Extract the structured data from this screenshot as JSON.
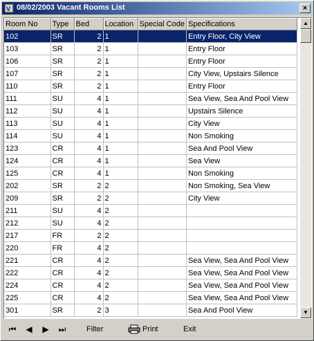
{
  "window": {
    "title": "08/02/2003 Vacant Rooms List",
    "close_label": "×"
  },
  "columns": [
    "Room No",
    "Type",
    "Bed",
    "Location",
    "Special Code",
    "Specifications"
  ],
  "rows": [
    [
      "102",
      "SR",
      "2",
      "1",
      "",
      "Entry Floor, City View"
    ],
    [
      "103",
      "SR",
      "2",
      "1",
      "",
      "Entry Floor"
    ],
    [
      "106",
      "SR",
      "2",
      "1",
      "",
      "Entry Floor"
    ],
    [
      "107",
      "SR",
      "2",
      "1",
      "",
      "City View, Upstairs Silence"
    ],
    [
      "110",
      "SR",
      "2",
      "1",
      "",
      "Entry Floor"
    ],
    [
      "111",
      "SU",
      "4",
      "1",
      "",
      "Sea View, Sea And Pool View"
    ],
    [
      "112",
      "SU",
      "4",
      "1",
      "",
      "Upstairs Silence"
    ],
    [
      "113",
      "SU",
      "4",
      "1",
      "",
      "City View"
    ],
    [
      "114",
      "SU",
      "4",
      "1",
      "",
      "Non Smoking"
    ],
    [
      "123",
      "CR",
      "4",
      "1",
      "",
      "Sea And Pool View"
    ],
    [
      "124",
      "CR",
      "4",
      "1",
      "",
      "Sea View"
    ],
    [
      "125",
      "CR",
      "4",
      "1",
      "",
      "Non Smoking"
    ],
    [
      "202",
      "SR",
      "2",
      "2",
      "",
      "Non Smoking, Sea View"
    ],
    [
      "209",
      "SR",
      "2",
      "2",
      "",
      "City View"
    ],
    [
      "211",
      "SU",
      "4",
      "2",
      "",
      ""
    ],
    [
      "212",
      "SU",
      "4",
      "2",
      "",
      ""
    ],
    [
      "217",
      "FR",
      "2",
      "2",
      "",
      ""
    ],
    [
      "220",
      "FR",
      "4",
      "2",
      "",
      ""
    ],
    [
      "221",
      "CR",
      "4",
      "2",
      "",
      "Sea View, Sea And Pool View"
    ],
    [
      "222",
      "CR",
      "4",
      "2",
      "",
      "Sea View, Sea And Pool View"
    ],
    [
      "224",
      "CR",
      "4",
      "2",
      "",
      "Sea View, Sea And Pool View"
    ],
    [
      "225",
      "CR",
      "4",
      "2",
      "",
      "Sea View, Sea And Pool View"
    ],
    [
      "301",
      "SR",
      "2",
      "3",
      "",
      "Sea And Pool View"
    ]
  ],
  "selected_row": 0,
  "toolbar": {
    "first_icon": "first-record-icon",
    "prev_icon": "previous-record-icon",
    "next_icon": "next-record-icon",
    "last_icon": "last-record-icon",
    "filter_label": "Filter",
    "print_label": "Print",
    "exit_label": "Exit"
  },
  "colors": {
    "title_start": "#0a246a",
    "title_end": "#a6caf0",
    "selection": "#0a246a",
    "face": "#d4d0c8"
  }
}
